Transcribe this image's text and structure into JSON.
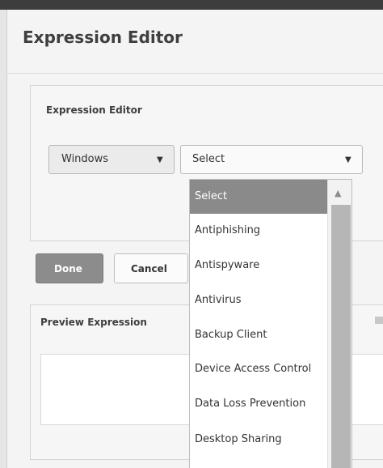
{
  "dialog": {
    "title": "Expression Editor"
  },
  "editor": {
    "section_label": "Expression Editor",
    "os_select": {
      "value": "Windows",
      "caret": "▼"
    },
    "category_select": {
      "value": "Select",
      "caret": "▼"
    }
  },
  "buttons": {
    "done": "Done",
    "cancel": "Cancel"
  },
  "preview": {
    "section_label": "Preview Expression"
  },
  "dropdown": {
    "items": [
      {
        "label": "Select",
        "selected": true
      },
      {
        "label": "Antiphishing"
      },
      {
        "label": "Antispyware"
      },
      {
        "label": "Antivirus"
      },
      {
        "label": "Backup Client"
      },
      {
        "label": "Device Access Control"
      },
      {
        "label": "Data Loss Prevention"
      },
      {
        "label": "Desktop Sharing"
      }
    ],
    "scroll_up_arrow": "▲"
  }
}
